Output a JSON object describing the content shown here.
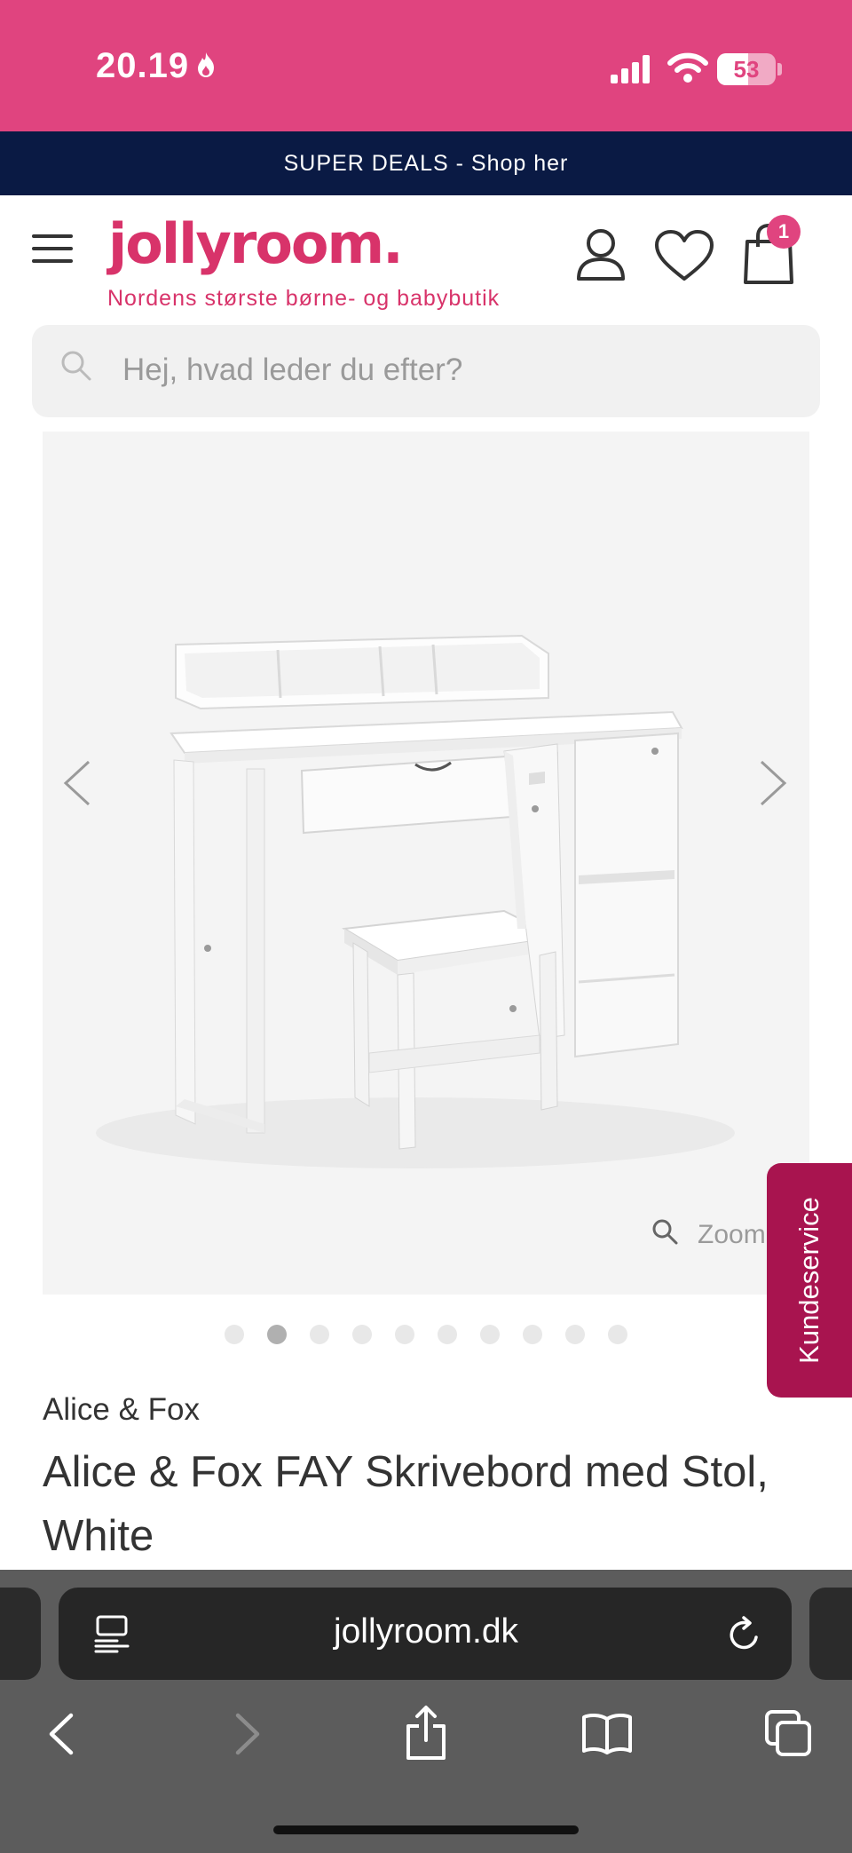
{
  "status_bar": {
    "time": "20.19",
    "battery": "53",
    "battery_level": 0.53
  },
  "promo": {
    "text": "SUPER DEALS - Shop her"
  },
  "header": {
    "logo": "jollyroom.",
    "tagline": "Nordens største børne- og babybutik",
    "cart_count": "1",
    "icons": [
      "menu-icon",
      "user-icon",
      "heart-icon",
      "shopping-bag-icon"
    ]
  },
  "search": {
    "placeholder": "Hej, hvad leder du efter?"
  },
  "gallery": {
    "zoom_label": "Zoom",
    "total_images": 10,
    "active_index": 1
  },
  "kundeservice": {
    "label": "Kundeservice"
  },
  "product": {
    "brand": "Alice & Fox",
    "title": "Alice & Fox FAY Skrivebord med Stol, White"
  },
  "browser": {
    "url": "jollyroom.dk"
  },
  "colors": {
    "brand_pink": "#e0447f",
    "promo_navy": "#0a1a44",
    "kundeservice": "#a8144f"
  }
}
